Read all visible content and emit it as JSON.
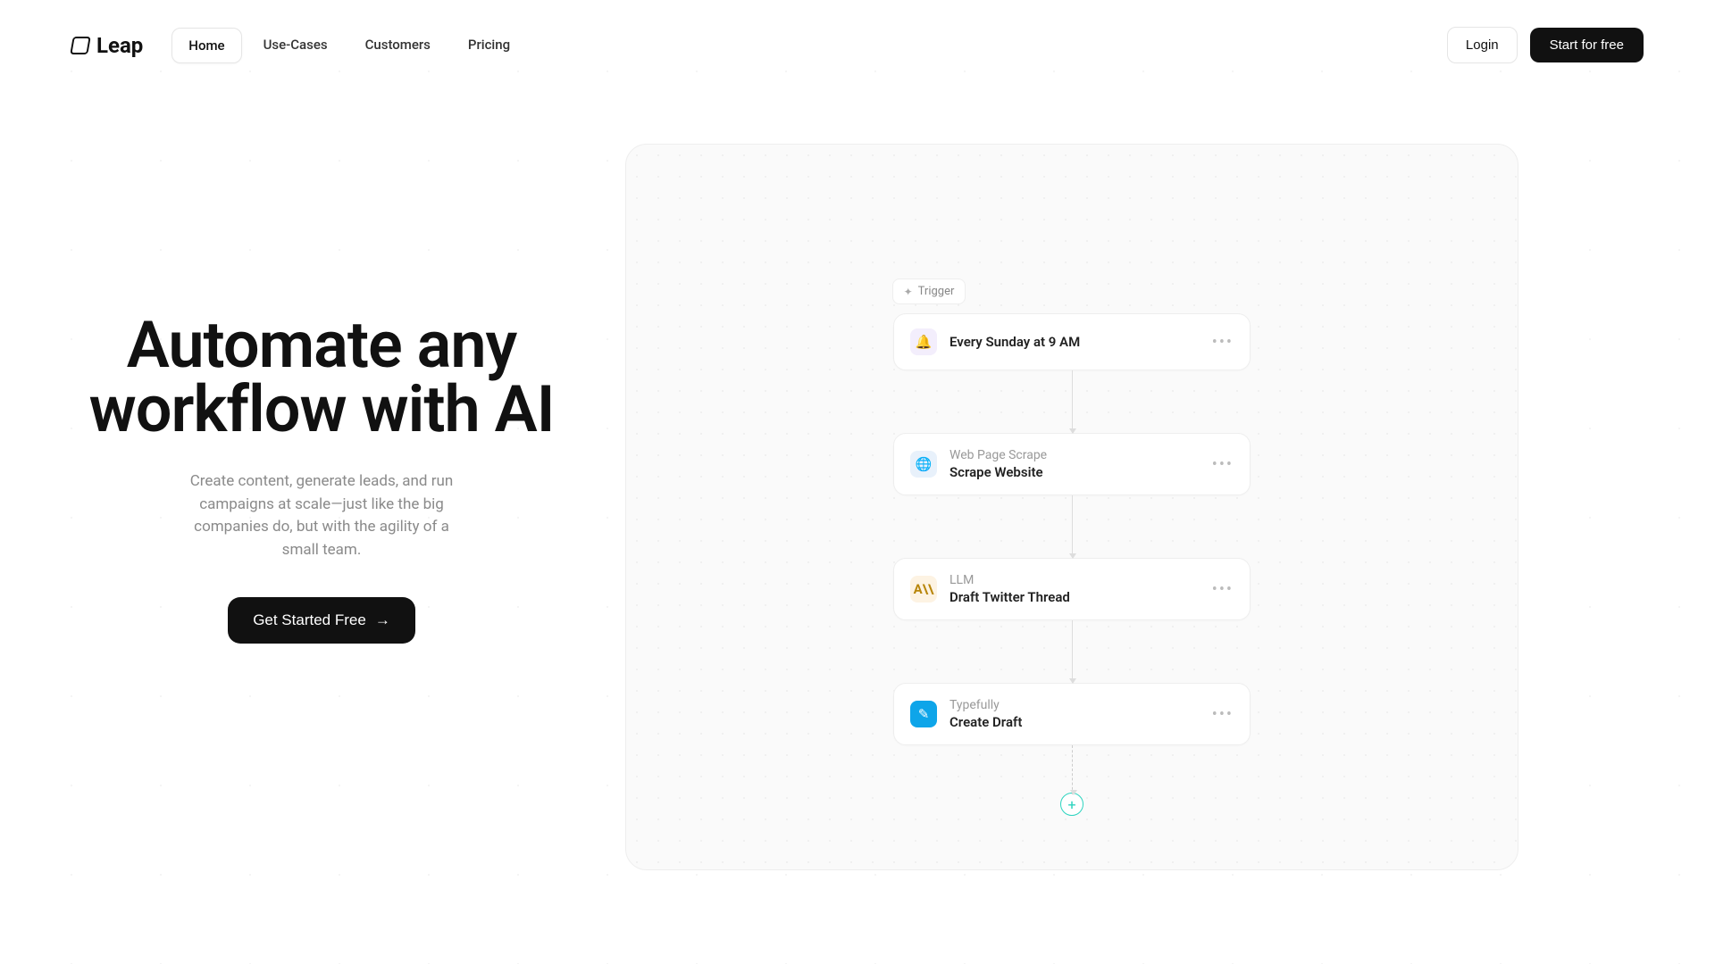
{
  "brand": "Leap",
  "nav": [
    {
      "label": "Home",
      "active": true
    },
    {
      "label": "Use-Cases",
      "active": false
    },
    {
      "label": "Customers",
      "active": false
    },
    {
      "label": "Pricing",
      "active": false
    }
  ],
  "header": {
    "login": "Login",
    "start": "Start for free"
  },
  "hero": {
    "title": "Automate any workflow with AI",
    "subtitle": "Create content, generate leads, and run campaigns at scale—just like the big companies do, but with the agility of a small team.",
    "cta": "Get Started Free"
  },
  "workflow": {
    "trigger_label": "Trigger",
    "nodes": [
      {
        "icon": "bell",
        "icon_glyph": "🔔",
        "icon_class": "bg-purple",
        "label": "",
        "title": "Every Sunday at 9 AM"
      },
      {
        "icon": "globe",
        "icon_glyph": "🌐",
        "icon_class": "bg-blue",
        "label": "Web Page Scrape",
        "title": "Scrape Website"
      },
      {
        "icon": "ai",
        "icon_glyph": "A\\\\",
        "icon_class": "bg-amber",
        "label": "LLM",
        "title": "Draft Twitter Thread"
      },
      {
        "icon": "pen",
        "icon_glyph": "✎",
        "icon_class": "bg-teal-solid",
        "label": "Typefully",
        "title": "Create Draft"
      }
    ]
  }
}
